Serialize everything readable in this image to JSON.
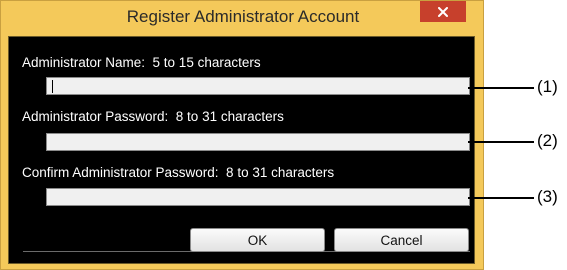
{
  "dialog": {
    "title": "Register Administrator Account",
    "close_label": "×",
    "fields": [
      {
        "label": "Administrator Name:  5 to 15 characters",
        "value": "",
        "callout": "(1)"
      },
      {
        "label": "Administrator Password:  8 to 31 characters",
        "value": "",
        "callout": "(2)"
      },
      {
        "label": "Confirm Administrator Password:  8 to 31 characters",
        "value": "",
        "callout": "(3)"
      }
    ],
    "buttons": {
      "ok": "OK",
      "cancel": "Cancel"
    }
  },
  "colors": {
    "frame": "#f4c95a",
    "close_button": "#c7402c",
    "client_background": "#000000",
    "input_background": "#f0f0f0"
  },
  "icons": {
    "close": "close-icon"
  }
}
